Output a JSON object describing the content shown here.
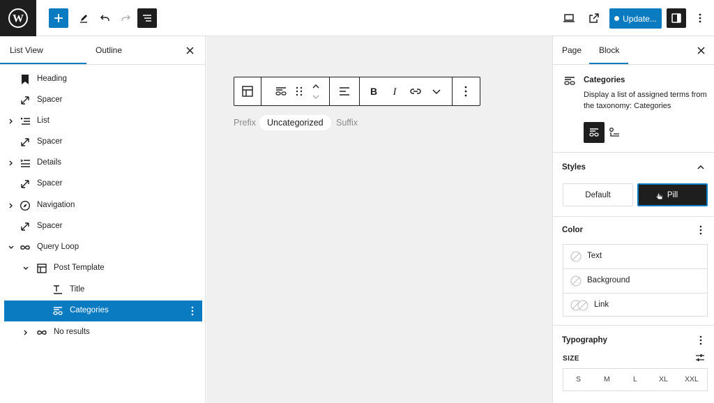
{
  "topbar": {
    "update_label": "Update..."
  },
  "left_panel": {
    "tab_list_view": "List View",
    "tab_outline": "Outline",
    "items": [
      {
        "label": "Heading"
      },
      {
        "label": "Spacer"
      },
      {
        "label": "List"
      },
      {
        "label": "Spacer"
      },
      {
        "label": "Details"
      },
      {
        "label": "Spacer"
      },
      {
        "label": "Navigation"
      },
      {
        "label": "Spacer"
      },
      {
        "label": "Query Loop"
      },
      {
        "label": "Post Template"
      },
      {
        "label": "Title"
      },
      {
        "label": "Categories"
      },
      {
        "label": "No results"
      }
    ]
  },
  "canvas": {
    "prefix": "Prefix",
    "term": "Uncategorized",
    "suffix": "Suffix"
  },
  "right_panel": {
    "tab_page": "Page",
    "tab_block": "Block",
    "block_title": "Categories",
    "block_description": "Display a list of assigned terms from the taxonomy: Categories",
    "styles_heading": "Styles",
    "style_default": "Default",
    "style_pill": "Pill",
    "color_heading": "Color",
    "color_items": [
      {
        "label": "Text"
      },
      {
        "label": "Background"
      },
      {
        "label": "Link"
      }
    ],
    "typography_heading": "Typography",
    "size_label": "SIZE",
    "sizes": [
      "S",
      "M",
      "L",
      "XL",
      "XXL"
    ]
  },
  "colors": {
    "accent": "#0b7bc1",
    "dark": "#1e1e1e"
  }
}
